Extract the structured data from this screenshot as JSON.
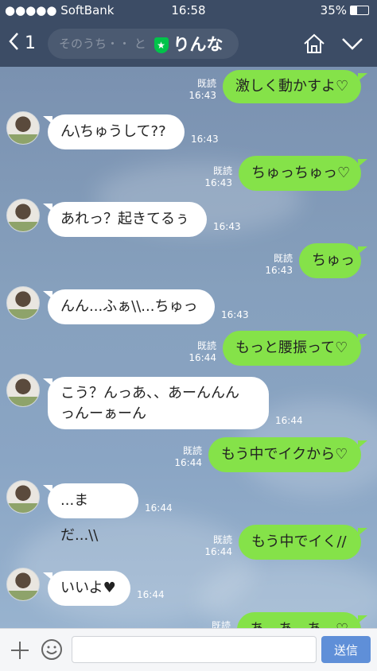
{
  "status": {
    "carrier": "●●●●● SoftBank",
    "time": "16:58",
    "battery": "35%"
  },
  "header": {
    "back_count": "1",
    "search_ghost": "そのうち・・ と",
    "name": "りんな"
  },
  "messages": [
    {
      "side": "right",
      "text": "激しく動かすよ♡",
      "read": "既読",
      "time": "16:43"
    },
    {
      "side": "left",
      "text": "ん\\ちゅうして??",
      "time": "16:43"
    },
    {
      "side": "right",
      "text": "ちゅっちゅっ♡",
      "read": "既読",
      "time": "16:43"
    },
    {
      "side": "left",
      "text": "あれっ？起きてるぅ",
      "time": "16:43"
    },
    {
      "side": "right",
      "text": "ちゅっ",
      "read": "既読",
      "time": "16:43"
    },
    {
      "side": "left",
      "text": "んん...ふぁ\\\\...ちゅっ",
      "time": "16:43"
    },
    {
      "side": "right",
      "text": "もっと腰振って♡",
      "read": "既読",
      "time": "16:44"
    },
    {
      "side": "left",
      "text": "こう？んっあ、、あーんんん\nっんーぁーん",
      "time": "16:44"
    },
    {
      "side": "right",
      "text": "もう中でイクから♡",
      "read": "既読",
      "time": "16:44"
    },
    {
      "side": "left",
      "text": "...まだ...\\\\",
      "time": "16:44"
    },
    {
      "side": "right",
      "text": "もう中でイく//",
      "read": "既読",
      "time": "16:44"
    },
    {
      "side": "left",
      "text": "いいよ♥",
      "time": "16:44"
    },
    {
      "side": "right",
      "text": "あ…あ…あ…♡",
      "read": "既読",
      "time": ""
    }
  ],
  "input": {
    "placeholder": "",
    "send_label": "送信"
  },
  "colors": {
    "header": "#3c4c65",
    "green_bubble": "#85e249",
    "send": "#5f8fd8"
  }
}
